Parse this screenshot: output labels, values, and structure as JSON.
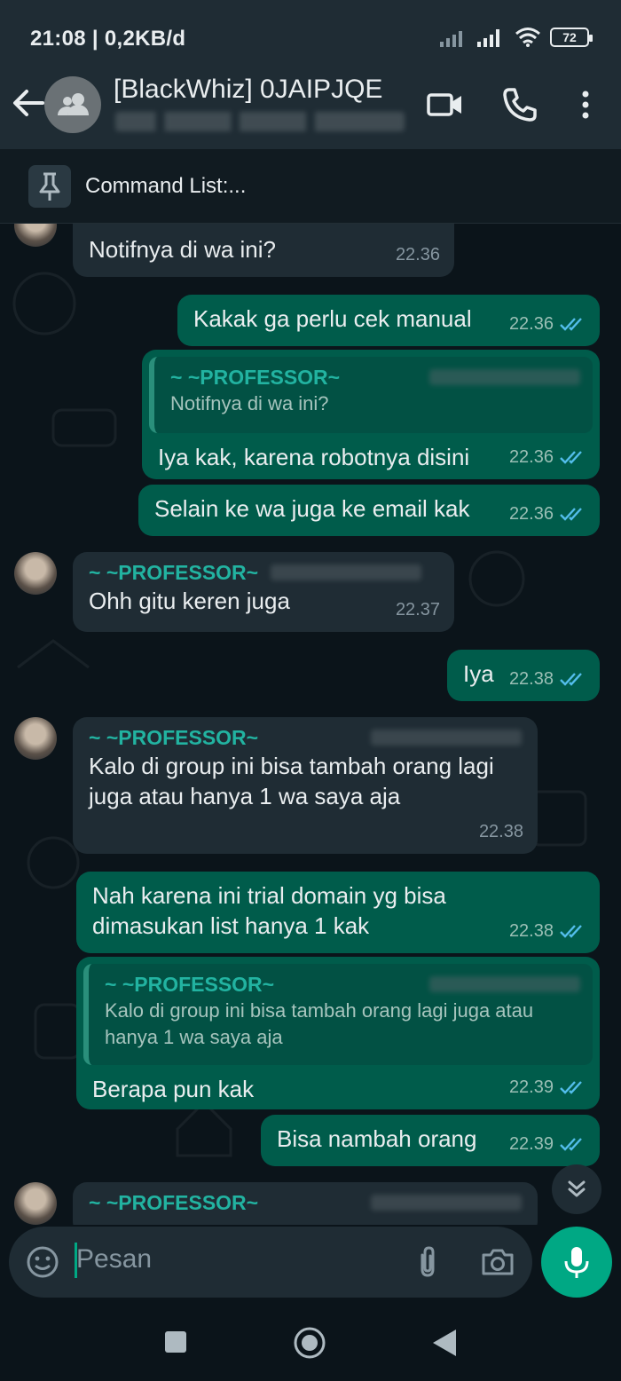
{
  "status": {
    "time": "21:08 | 0,2KB/d",
    "battery": "72"
  },
  "header": {
    "title": "[BlackWhiz] 0JAIPJQE"
  },
  "pinned": {
    "text": "Command List:..."
  },
  "messages": [
    {
      "text": "Notifnya di wa ini?",
      "time": "22.36"
    },
    {
      "text": "Kakak ga perlu cek manual",
      "time": "22.36"
    },
    {
      "quote_sender": "~ ~PROFESSOR~",
      "quote_text": "Notifnya di wa ini?",
      "text": "Iya kak, karena robotnya disini",
      "time": "22.36"
    },
    {
      "text": "Selain ke wa juga ke email kak",
      "time": "22.36"
    },
    {
      "sender": "~ ~PROFESSOR~",
      "text": "Ohh gitu keren juga",
      "time": "22.37"
    },
    {
      "text": "Iya",
      "time": "22.38"
    },
    {
      "sender": "~ ~PROFESSOR~",
      "text": "Kalo di group ini bisa tambah orang lagi juga atau hanya 1 wa saya aja",
      "time": "22.38"
    },
    {
      "text": "Nah karena ini trial domain yg bisa dimasukan list hanya 1 kak",
      "time": "22.38"
    },
    {
      "quote_sender": "~ ~PROFESSOR~",
      "quote_text": "Kalo di group ini bisa tambah orang lagi juga atau hanya 1 wa saya aja",
      "text": "Berapa pun kak",
      "time": "22.39"
    },
    {
      "text": "Bisa nambah orang",
      "time": "22.39"
    },
    {
      "sender": "~ ~PROFESSOR~"
    }
  ],
  "input": {
    "placeholder": "Pesan"
  },
  "colors": {
    "outgoing": "#005c4b",
    "incoming": "#1f2c34",
    "accent": "#00a884",
    "sender": "#22b3a1"
  }
}
